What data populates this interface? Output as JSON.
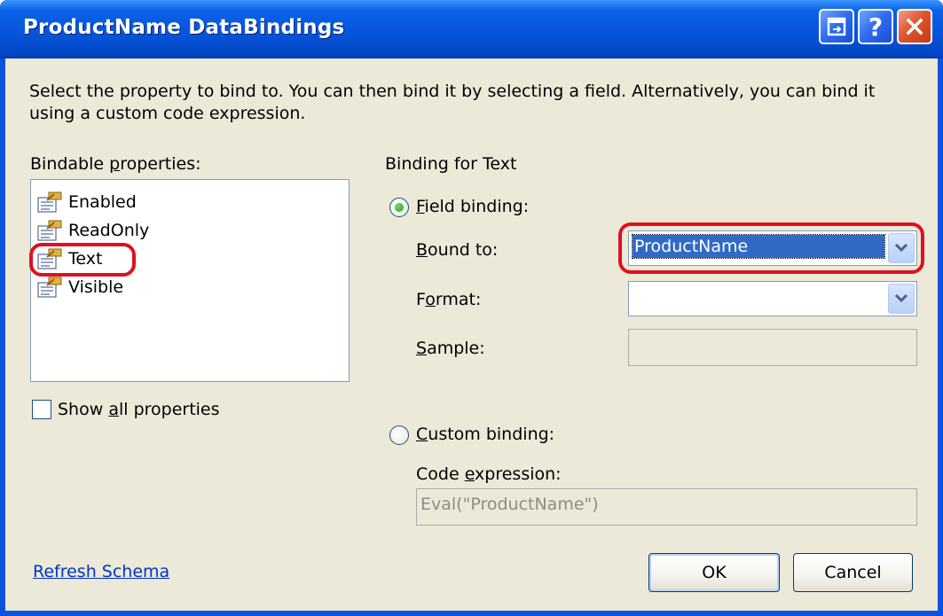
{
  "window": {
    "title": "ProductName DataBindings"
  },
  "description": "Select the property to bind to. You can then bind it by selecting a field. Alternatively, you can bind it using a custom code expression.",
  "bindable": {
    "label_pre": "Bindable ",
    "label_key": "p",
    "label_post": "roperties:",
    "items": [
      {
        "label": "Enabled"
      },
      {
        "label": "ReadOnly"
      },
      {
        "label": "Text"
      },
      {
        "label": "Visible"
      }
    ],
    "selected": "Text",
    "show_all_pre": "Show ",
    "show_all_key": "a",
    "show_all_post": "ll properties"
  },
  "binding": {
    "header": "Binding for Text",
    "field_binding_key": "F",
    "field_binding_post": "ield binding:",
    "bound_to_key": "B",
    "bound_to_post": "ound to:",
    "bound_to_value": "ProductName",
    "format_pre": "F",
    "format_key": "o",
    "format_post": "rmat:",
    "format_value": "",
    "sample_key": "S",
    "sample_post": "ample:",
    "custom_binding_key": "C",
    "custom_binding_post": "ustom binding:",
    "code_expression_pre": "Code ",
    "code_expression_key": "e",
    "code_expression_post": "xpression:",
    "code_expression_value": "Eval(\"ProductName\")",
    "mode": "field"
  },
  "footer": {
    "refresh_schema": "Refresh Schema",
    "ok": "OK",
    "cancel": "Cancel"
  },
  "colors": {
    "highlight": "#e01020",
    "title_bar": "#0654d8",
    "dialog_face": "#ece9d8"
  }
}
